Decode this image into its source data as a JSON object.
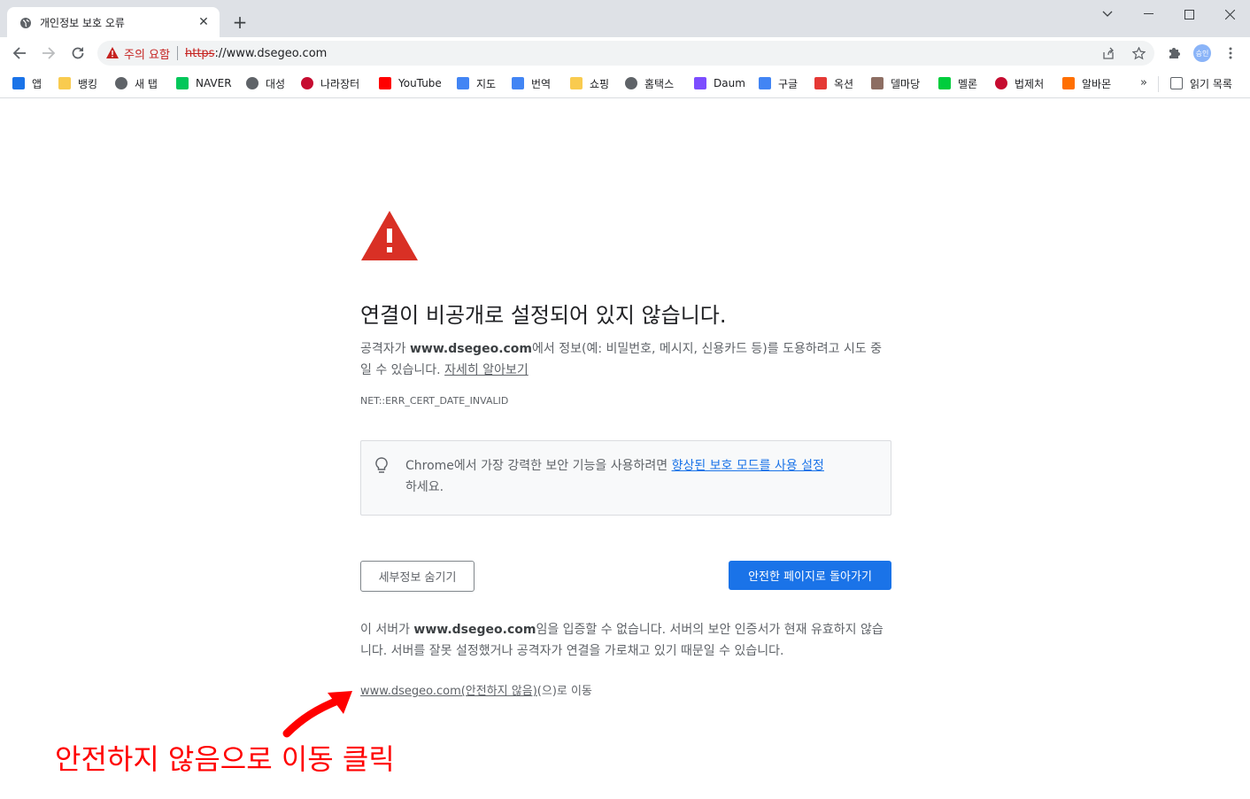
{
  "tab": {
    "title": "개인정보 보호 오류",
    "close_glyph": "✕"
  },
  "toolbar": {
    "security_label": "주의 요함",
    "url_scheme": "https",
    "url_rest": "://www.dsegeo.com",
    "avatar_text": "승인"
  },
  "bookmarks": [
    {
      "label": "앱",
      "icon": "apps-grid-icon",
      "color": "#1a73e8"
    },
    {
      "label": "뱅킹",
      "icon": "folder-icon",
      "color": "#f9cb4f"
    },
    {
      "label": "새 탭",
      "icon": "globe-icon",
      "color": "#5f6368"
    },
    {
      "label": "NAVER",
      "icon": "naver-icon",
      "color": "#03c75a"
    },
    {
      "label": "대성",
      "icon": "globe-icon",
      "color": "#5f6368"
    },
    {
      "label": "나라장터",
      "icon": "korea-gov-icon",
      "color": "#c60c30"
    },
    {
      "label": "YouTube",
      "icon": "youtube-icon",
      "color": "#ff0000"
    },
    {
      "label": "지도",
      "icon": "map-pin-icon",
      "color": "#4285f4"
    },
    {
      "label": "번역",
      "icon": "translate-icon",
      "color": "#4285f4"
    },
    {
      "label": "쇼핑",
      "icon": "folder-icon",
      "color": "#f9cb4f"
    },
    {
      "label": "홈택스",
      "icon": "globe-icon",
      "color": "#5f6368"
    },
    {
      "label": "Daum",
      "icon": "daum-icon",
      "color": "#7c4dff"
    },
    {
      "label": "구글",
      "icon": "google-icon",
      "color": "#4285f4"
    },
    {
      "label": "옥션",
      "icon": "auction-icon",
      "color": "#e53935"
    },
    {
      "label": "델마당",
      "icon": "person-icon",
      "color": "#8d6e63"
    },
    {
      "label": "멜론",
      "icon": "melon-icon",
      "color": "#00cd3c"
    },
    {
      "label": "법제처",
      "icon": "korea-gov-icon",
      "color": "#c60c30"
    },
    {
      "label": "알바몬",
      "icon": "albamon-icon",
      "color": "#ff6f00"
    }
  ],
  "reading_list_label": "읽기 목록",
  "page": {
    "heading": "연결이 비공개로 설정되어 있지 않습니다.",
    "desc_before": "공격자가 ",
    "desc_host": "www.dsegeo.com",
    "desc_after": "에서 정보(예: 비밀번호, 메시지, 신용카드 등)를 도용하려고 시도 중일 수 있습니다. ",
    "learn_more": "자세히 알아보기",
    "error_code": "NET::ERR_CERT_DATE_INVALID",
    "info_before": "Chrome에서 가장 강력한 보안 기능을 사용하려면 ",
    "info_link": "향상된 보호 모드를 사용 설정",
    "info_after": "하세요.",
    "hide_details_button": "세부정보 숨기기",
    "back_to_safety_button": "안전한 페이지로 돌아가기",
    "details_before": "이 서버가 ",
    "details_host": "www.dsegeo.com",
    "details_after": "임을 입증할 수 없습니다. 서버의 보안 인증서가 현재 유효하지 않습니다. 서버를 잘못 설정했거나 공격자가 연결을 가로채고 있기 때문일 수 있습니다.",
    "proceed_link": "www.dsegeo.com(안전하지 않음)",
    "proceed_after": "(으)로 이동"
  },
  "annotation": {
    "text": "안전하지 않음으로 이동 클릭",
    "color": "#ff0000"
  },
  "colors": {
    "primary_blue": "#1a73e8",
    "warning_red": "#d93025",
    "tabstrip": "#dee1e6"
  }
}
